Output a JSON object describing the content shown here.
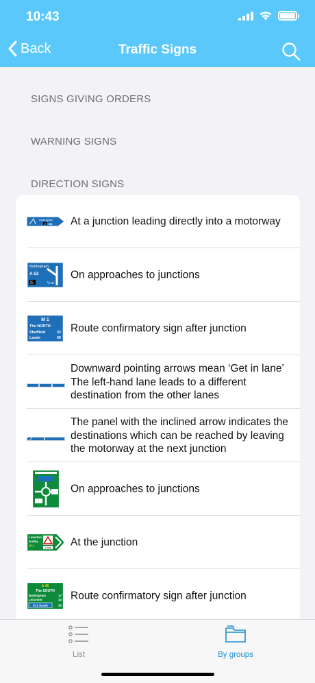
{
  "status_bar": {
    "time": "10:43"
  },
  "nav": {
    "back_label": "Back",
    "title": "Traffic Signs"
  },
  "sections": [
    {
      "title": "SIGNS GIVING ORDERS"
    },
    {
      "title": "WARNING SIGNS"
    },
    {
      "title": "DIRECTION SIGNS"
    }
  ],
  "signs": {
    "s1": {
      "place": "Nottingham",
      "route": "M1",
      "junction": "25"
    },
    "s2": {
      "place": "Nottingham",
      "route": "A 52",
      "distance": "½ m",
      "junction": "25"
    },
    "s3": {
      "route": "M 1",
      "line1": "The NORTH",
      "place1": "Sheffield",
      "d1": "32",
      "place2": "Leeds",
      "d2": "59"
    },
    "s7": {
      "place1": "Lamston",
      "place2": "Antley",
      "route": "A11",
      "distance": "1 mile"
    },
    "s8": {
      "route": "A 46",
      "line1": "The SOUTH",
      "place1": "Nottingham",
      "d1": "17",
      "place2": "Leicester",
      "d2": "32",
      "motorway": "M 1 South",
      "d3": "35"
    }
  },
  "items": [
    {
      "label": "At a junction leading directly into a motorway"
    },
    {
      "label": "On approaches to junctions"
    },
    {
      "label": "Route confirmatory sign after junction"
    },
    {
      "label": "Downward pointing arrows mean ‘Get in lane’ The left-hand lane leads to a different destination from the other lanes"
    },
    {
      "label": "The panel with the inclined arrow indicates the destinations which can be reached by leaving the motorway at the next junction"
    },
    {
      "label": "On approaches to junctions"
    },
    {
      "label": "At the junction"
    },
    {
      "label": "Route confirmatory sign after junction"
    }
  ],
  "tabs": [
    {
      "label": "List",
      "icon": "list-icon",
      "active": false
    },
    {
      "label": "By groups",
      "icon": "folder-icon",
      "active": true
    }
  ],
  "colors": {
    "accent": "#5ac8fa",
    "tab_active": "#1a8fd0",
    "tab_inactive": "#8e8e93",
    "sign_blue": "#1f6fb8",
    "sign_green": "#0d8a3a"
  }
}
